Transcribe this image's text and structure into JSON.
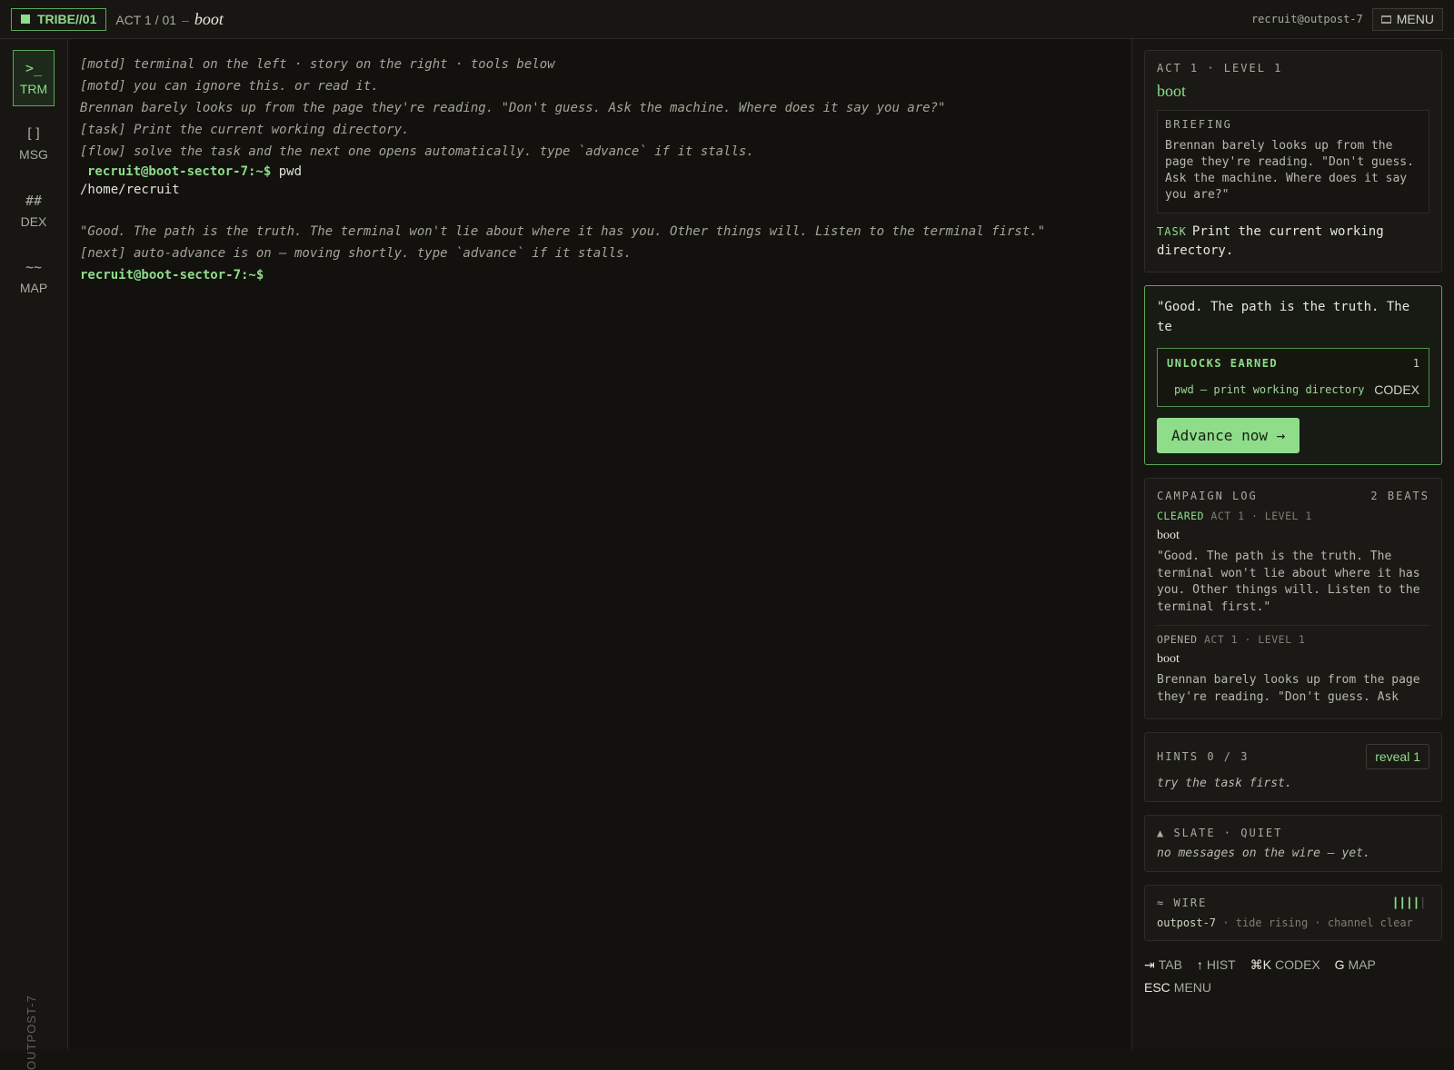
{
  "topbar": {
    "brand": "TRIBE//01",
    "act": "ACT 1 / 01",
    "separator": "–",
    "level_name": "boot",
    "user": "recruit@outpost-7",
    "menu_label": "MENU"
  },
  "rail": {
    "items": [
      {
        "glyph": ">_",
        "label": "TRM"
      },
      {
        "glyph": "[]",
        "label": "MSG"
      },
      {
        "glyph": "##",
        "label": "DEX"
      },
      {
        "glyph": "~~",
        "label": "MAP"
      }
    ],
    "footer": "OUTPOST-7"
  },
  "terminal": {
    "lines": [
      "[motd] terminal on the left · story on the right · tools below",
      "[motd] you can ignore this. or read it.",
      "Brennan barely looks up from the page they're reading. \"Don't guess. Ask the machine. Where does it say you are?\"",
      "[task] Print the current working directory.",
      "[flow] solve the task and the next one opens automatically. type `advance` if it stalls."
    ],
    "prompt": "recruit@boot-sector-7:~$",
    "command": "pwd",
    "output": "/home/recruit",
    "response_lines": [
      "\"Good. The path is the truth. The terminal won't lie about where it has you. Other things will. Listen to the terminal first.\"",
      "[next] auto-advance is on — moving shortly. type `advance` if it stalls."
    ]
  },
  "side": {
    "level_card": {
      "label": "ACT 1 · LEVEL 1",
      "title": "boot",
      "briefing_label": "BRIEFING",
      "briefing_text": "Brennan barely looks up from the page they're reading. \"Don't guess. Ask the machine. Where does it say you are?\"",
      "task_label": "TASK",
      "task_text": "Print the current working directory."
    },
    "result_card": {
      "quote": "\"Good. The path is the truth. The te",
      "unlocks_label": "UNLOCKS EARNED",
      "unlocks_count": "1",
      "unlock_cmd": "pwd — print working directory",
      "unlock_tag": "CODEX",
      "advance_label": "Advance now →"
    },
    "log": {
      "label": "CAMPAIGN LOG",
      "count": "2 BEATS",
      "entries": [
        {
          "status": "CLEARED",
          "meta": "ACT 1 · LEVEL 1",
          "name": "boot",
          "body": "\"Good. The path is the truth. The terminal won't lie about where it has you. Other things will. Listen to the terminal first.\""
        },
        {
          "status": "OPENED",
          "meta": "ACT 1 · LEVEL 1",
          "name": "boot",
          "body": "Brennan barely looks up from the page they're reading. \"Don't guess. Ask"
        }
      ]
    },
    "hints": {
      "label": "HINTS 0 / 3",
      "reveal_label": "reveal 1",
      "note": "try the task first."
    },
    "slate": {
      "label": "▲ SLATE · QUIET",
      "note": "no messages on the wire — yet."
    },
    "wire": {
      "label": "≈ WIRE",
      "signal_level": 0.8,
      "host": "outpost-7",
      "status": "· tide rising · channel clear"
    },
    "shortcuts": [
      {
        "key": "⇥",
        "label": "TAB"
      },
      {
        "key": "↑",
        "label": "HIST"
      },
      {
        "key": "⌘K",
        "label": "CODEX"
      },
      {
        "key": "G",
        "label": "MAP"
      },
      {
        "key": "ESC",
        "label": "MENU"
      }
    ]
  },
  "colors": {
    "accent": "#8fdc8a",
    "background": "#141310",
    "border_accent": "#5aa65a"
  }
}
